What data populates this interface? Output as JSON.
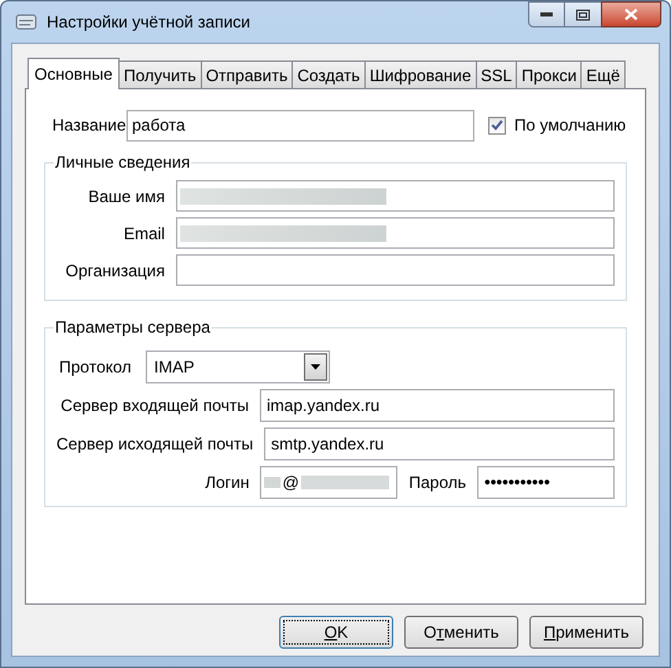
{
  "window": {
    "title": "Настройки учётной записи"
  },
  "tabs": [
    {
      "label": "Основные",
      "selected": true
    },
    {
      "label": "Получить",
      "selected": false
    },
    {
      "label": "Отправить",
      "selected": false
    },
    {
      "label": "Создать",
      "selected": false
    },
    {
      "label": "Шифрование",
      "selected": false
    },
    {
      "label": "SSL",
      "selected": false
    },
    {
      "label": "Прокси",
      "selected": false
    },
    {
      "label": "Ещё",
      "selected": false
    }
  ],
  "name_field": {
    "label": "Название",
    "value": "работа"
  },
  "default_checkbox": {
    "label": "По умолчанию",
    "checked": true
  },
  "personal": {
    "title": "Личные сведения",
    "fields": [
      {
        "label": "Ваше имя",
        "redacted": true
      },
      {
        "label": "Email",
        "redacted": true
      },
      {
        "label": "Организация",
        "redacted": false
      }
    ]
  },
  "server": {
    "title": "Параметры сервера",
    "protocol": {
      "label": "Протокол",
      "value": "IMAP"
    },
    "incoming": {
      "label": "Сервер входящей почты",
      "value": "imap.yandex.ru"
    },
    "outgoing": {
      "label": "Сервер исходящей почты",
      "value": "smtp.yandex.ru"
    },
    "login": {
      "label": "Логин",
      "value": "@"
    },
    "password": {
      "label": "Пароль",
      "value": "●●●●●●●●●●●"
    }
  },
  "buttons": [
    {
      "key": "O",
      "after": "K",
      "default": true
    },
    {
      "before": "О",
      "key": "т",
      "after": "менить",
      "default": false
    },
    {
      "key": "П",
      "after": "рименить",
      "default": false
    }
  ]
}
